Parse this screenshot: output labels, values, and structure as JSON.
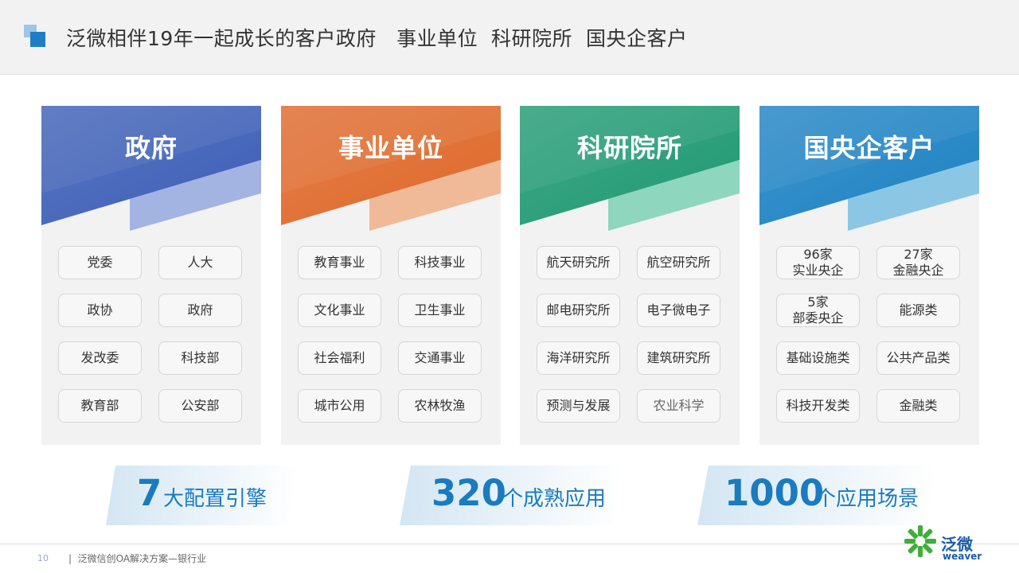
{
  "header": {
    "title": "泛微相伴19年一起成长的客户政府   事业单位  科研院所  国央企客户"
  },
  "cards": [
    {
      "title": "政府",
      "theme_color": "#3d5fb8",
      "accent_color": "#9aace0",
      "tags": [
        [
          "党委"
        ],
        [
          "人大"
        ],
        [
          "政协"
        ],
        [
          "政府"
        ],
        [
          "发改委"
        ],
        [
          "科技部"
        ],
        [
          "教育部"
        ],
        [
          "公安部"
        ]
      ]
    },
    {
      "title": "事业单位",
      "theme_color": "#e0692a",
      "accent_color": "#f0b48e",
      "tags": [
        [
          "教育事业"
        ],
        [
          "科技事业"
        ],
        [
          "文化事业"
        ],
        [
          "卫生事业"
        ],
        [
          "社会福利"
        ],
        [
          "交通事业"
        ],
        [
          "城市公用"
        ],
        [
          "农林牧渔"
        ]
      ]
    },
    {
      "title": "科研院所",
      "theme_color": "#1f9a72",
      "accent_color": "#84d3b8",
      "tags": [
        [
          "航天研究所"
        ],
        [
          "航空研究所"
        ],
        [
          "邮电研究所"
        ],
        [
          "电子微电子"
        ],
        [
          "海洋研究所"
        ],
        [
          "建筑研究所"
        ],
        [
          "预测与发展"
        ],
        [
          "农业科学"
        ]
      ]
    },
    {
      "title": "国央企客户",
      "theme_color": "#1d83c4",
      "accent_color": "#7fc2e3",
      "tags": [
        [
          "96家",
          "实业央企"
        ],
        [
          "27家",
          "金融央企"
        ],
        [
          "5家",
          "部委央企"
        ],
        [
          "能源类"
        ],
        [
          "基础设施类"
        ],
        [
          "公共产品类"
        ],
        [
          "科技开发类"
        ],
        [
          "金融类"
        ]
      ]
    }
  ],
  "stats": [
    {
      "number": "7",
      "label": "大配置引擎"
    },
    {
      "number": "320",
      "label": "个成熟应用"
    },
    {
      "number": "1000",
      "label": "个应用场景"
    }
  ],
  "footer": {
    "page_number": "10",
    "text": "|  泛微信创OA解决方案—银行业",
    "logo_cn": "泛微",
    "logo_en": "weaver"
  }
}
